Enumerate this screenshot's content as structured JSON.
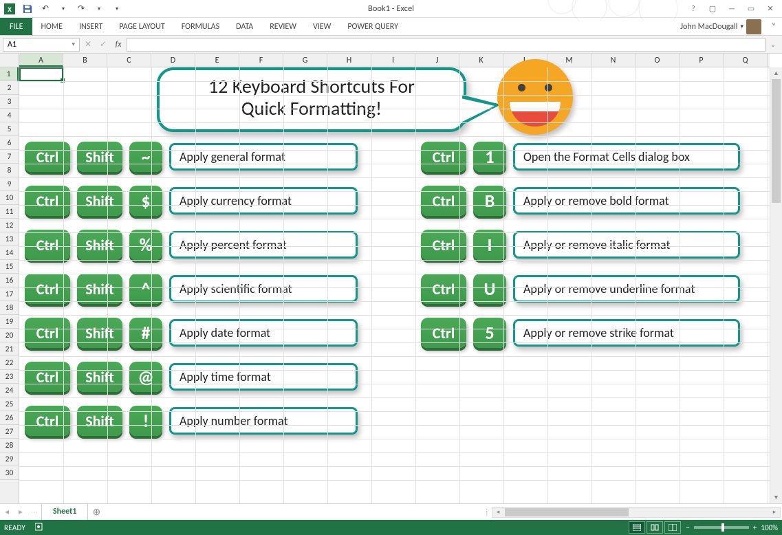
{
  "window": {
    "title": "Book1 - Excel"
  },
  "ribbon": {
    "file": "FILE",
    "tabs": [
      "HOME",
      "INSERT",
      "PAGE LAYOUT",
      "FORMULAS",
      "DATA",
      "REVIEW",
      "VIEW",
      "POWER QUERY"
    ],
    "signin": "John MacDougall"
  },
  "namebox": "A1",
  "columns": [
    "A",
    "B",
    "C",
    "D",
    "E",
    "F",
    "G",
    "H",
    "I",
    "J",
    "K",
    "L",
    "M",
    "N",
    "O",
    "P",
    "Q"
  ],
  "rowcount": 30,
  "bubble": {
    "line1": "12 Keyboard Shortcuts For",
    "line2": "Quick Formatting!"
  },
  "left_shortcuts": [
    {
      "keys": [
        "Ctrl",
        "Shift",
        "~"
      ],
      "desc": "Apply general format"
    },
    {
      "keys": [
        "Ctrl",
        "Shift",
        "$"
      ],
      "desc": "Apply currency format"
    },
    {
      "keys": [
        "Ctrl",
        "Shift",
        "%"
      ],
      "desc": "Apply percent format"
    },
    {
      "keys": [
        "Ctrl",
        "Shift",
        "^"
      ],
      "desc": "Apply scientific format"
    },
    {
      "keys": [
        "Ctrl",
        "Shift",
        "#"
      ],
      "desc": "Apply date format"
    },
    {
      "keys": [
        "Ctrl",
        "Shift",
        "@"
      ],
      "desc": "Apply time format"
    },
    {
      "keys": [
        "Ctrl",
        "Shift",
        "!"
      ],
      "desc": "Apply number format"
    }
  ],
  "right_shortcuts": [
    {
      "keys": [
        "Ctrl",
        "1"
      ],
      "desc": "Open the Format Cells dialog box"
    },
    {
      "keys": [
        "Ctrl",
        "B"
      ],
      "desc": "Apply or remove bold format"
    },
    {
      "keys": [
        "Ctrl",
        "I"
      ],
      "desc": "Apply or remove italic format"
    },
    {
      "keys": [
        "Ctrl",
        "U"
      ],
      "desc": "Apply or remove underline format"
    },
    {
      "keys": [
        "Ctrl",
        "5"
      ],
      "desc": "Apply or remove strike format"
    }
  ],
  "sheet": {
    "name": "Sheet1"
  },
  "status": {
    "ready": "READY",
    "zoom": "100%"
  }
}
